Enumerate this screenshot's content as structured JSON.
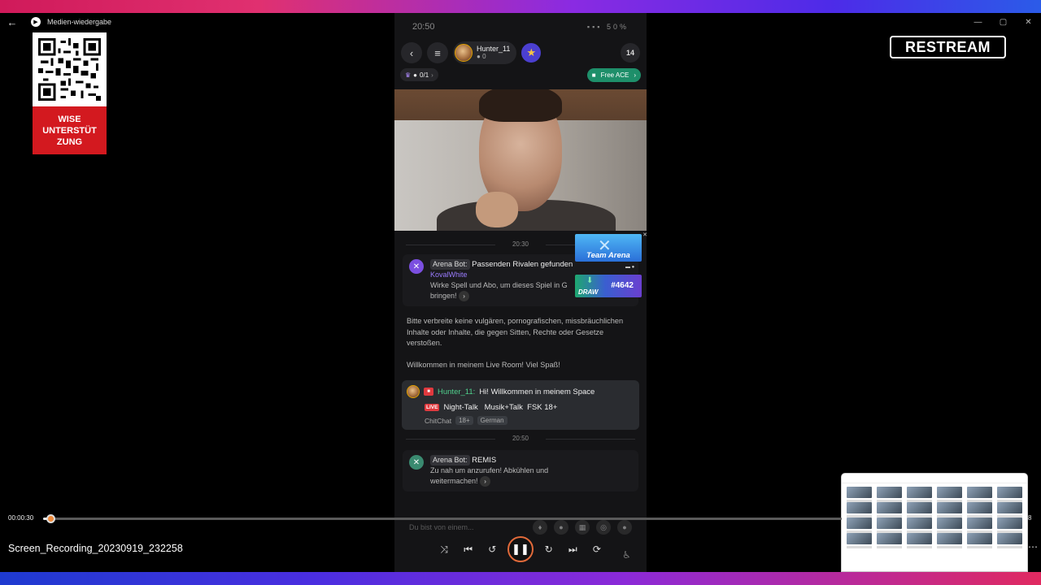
{
  "app": {
    "title": "Medien-wiedergabe",
    "back_glyph": "←",
    "window_controls": [
      "—",
      "▢",
      "✕"
    ]
  },
  "overlay": {
    "qr_label": "WISE\nUNTERSTÜT\nZUNG",
    "restream_logo": "RESTREAM"
  },
  "phone": {
    "status_time": "20:50",
    "status_battery": "50%",
    "host_name": "Hunter_11",
    "host_count": "0",
    "viewer_count": "14",
    "seat_label": "0/1",
    "ace_label": "Free ACE",
    "banners": {
      "arena": "Team Arena",
      "draw_label": "DRAW",
      "draw_number": "#4642"
    },
    "chat": {
      "time1": "20:30",
      "bot1_name": "Arena Bot:",
      "bot1_text": "Passenden Rivalen gefunden",
      "bot1_rival": "KovalWhite",
      "bot1_sub": "Wirke Spell und Abo, um dieses Spiel in G",
      "bot1_sub2": "bringen!",
      "rules": "Bitte verbreite keine vulgären, pornografischen, missbräuchlichen Inhalte oder Inhalte, die gegen Sitten, Rechte oder Gesetze verstoßen.",
      "welcome": "Willkommen in meinem Live Room! Viel Spaß!",
      "host_name": "Hunter_11:",
      "host_text": "Hi! Willkommen in meinem Space",
      "live_badge": "LIVE",
      "live_title": "Night-Talk   Musik+Talk  FSK 18+",
      "category": "ChitChat",
      "tags": [
        "18+",
        "German"
      ],
      "time2": "20:50",
      "bot2_name": "Arena Bot:",
      "bot2_text": "REMIS",
      "bot2_sub": "Zu nah um anzurufen! Abkühlen und",
      "bot2_sub2": "weitermachen!"
    },
    "input_placeholder": "Du bist von einem..."
  },
  "player": {
    "current_time": "00:00:30",
    "end_time": "8",
    "progress_fraction": 0.009,
    "filename": "Screen_Recording_20230919_232258",
    "more_glyph": "⋯"
  },
  "colors": {
    "accent": "#e26a3a",
    "qr_red": "#d3191f",
    "ace_green": "#1e8f6a",
    "bot_purple": "#7b4fe0"
  }
}
